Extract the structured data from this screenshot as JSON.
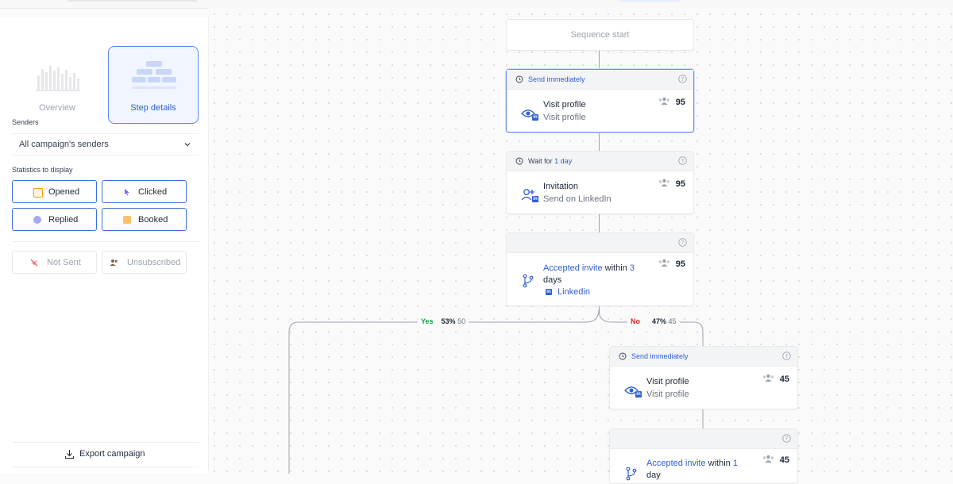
{
  "left_panel": {
    "view_tabs": [
      {
        "label": "Overview",
        "active": false
      },
      {
        "label": "Step details",
        "active": true
      }
    ],
    "senders": {
      "section_label": "Senders",
      "selected": "All campaign's senders"
    },
    "statistics": {
      "section_label": "Statistics to display",
      "buttons": [
        {
          "label": "Opened",
          "color": "#f59e0b",
          "icon": "envelope-open-icon"
        },
        {
          "label": "Clicked",
          "color": "#8b5cf6",
          "icon": "cursor-icon"
        },
        {
          "label": "Replied",
          "color": "#7c7cf0",
          "icon": "chat-bubble-icon"
        },
        {
          "label": "Booked",
          "color": "#f59e0b",
          "icon": "calendar-icon"
        }
      ],
      "disabled_buttons": [
        {
          "label": "Not Sent",
          "icon": "not-sent-icon"
        },
        {
          "label": "Unsubscribed",
          "icon": "unsubscribed-user-icon"
        }
      ]
    },
    "export_label": "Export campaign"
  },
  "flow": {
    "start_label": "Sequence start",
    "nodes": [
      {
        "header_prefix": "",
        "header_highlight": "Send immediately",
        "title": "Visit profile",
        "subtitle": "Visit profile",
        "count": "95"
      },
      {
        "header_prefix": "Wait for ",
        "header_highlight": "1 day",
        "title": "Invitation",
        "subtitle": "Send on LinkedIn",
        "count": "95"
      },
      {
        "condition_part1": "Accepted invite",
        "condition_part2": " within ",
        "condition_part3": "3",
        "condition_part4": "days",
        "subtitle": "Linkedin",
        "count": "95"
      },
      {
        "header_prefix": "",
        "header_highlight": "Send immediately",
        "title": "Visit profile",
        "subtitle": "Visit profile",
        "count": "45"
      },
      {
        "condition_part1": "Accepted invite",
        "condition_part2": " within ",
        "condition_part3": "1",
        "condition_part4": "day",
        "count": "45"
      }
    ],
    "branches": {
      "yes": {
        "label": "Yes",
        "percent": "53%",
        "count": "50"
      },
      "no": {
        "label": "No",
        "percent": "47%",
        "count": "45"
      }
    }
  }
}
